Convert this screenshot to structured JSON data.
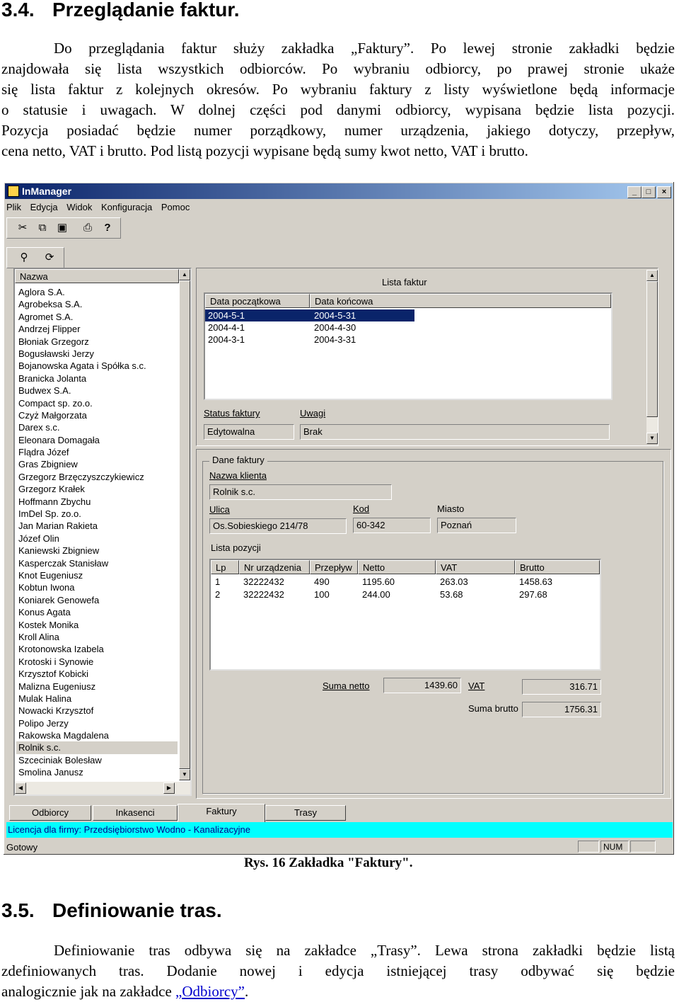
{
  "sec1": {
    "num": "3.4.",
    "title": "Przeglądanie faktur."
  },
  "para1": [
    "Do przeglądania faktur służy zakładka „Faktury”. Po lewej stronie zakładki będzie",
    "znajdowała się lista wszystkich odbiorców. Po wybraniu odbiorcy, po prawej stronie ukaże",
    "się lista faktur z kolejnych okresów. Po wybraniu faktury z listy wyświetlone będą informacje",
    "o statusie i uwagach. W dolnej części pod danymi odbiorcy, wypisana będzie lista pozycji.",
    "Pozycja posiadać będzie numer porządkowy, numer urządzenia, jakiego dotyczy, przepływ,",
    "cena netto, VAT i brutto. Pod listą pozycji wypisane będą sumy kwot netto, VAT i brutto."
  ],
  "window": {
    "title": "InManager",
    "buttons": {
      "min": "_",
      "max": "□",
      "close": "×"
    },
    "menu": [
      "Plik",
      "Edycja",
      "Widok",
      "Konfiguracja",
      "Pomoc"
    ],
    "icons": [
      "scissors-icon",
      "copy-icon",
      "paste-icon",
      "print-icon",
      "help-icon",
      "search-icon",
      "refresh-icon"
    ],
    "customers": {
      "header": "Nazwa",
      "items": [
        "Aglora S.A.",
        "Agrobeksa S.A.",
        "Agromet S.A.",
        "Andrzej Flipper",
        "Błoniak Grzegorz",
        "Bogusławski Jerzy",
        "Bojanowska Agata i Spółka s.c.",
        "Branicka Jolanta",
        "Budwex S.A.",
        "Compact sp. zo.o.",
        "Czyż Małgorzata",
        "Darex s.c.",
        "Eleonara Domagała",
        "Flądra Józef",
        "Gras Zbigniew",
        "Grzegorz Brzęczyszczykiewicz",
        "Grzegorz Krałek",
        "Hoffmann Zbychu",
        "ImDel Sp. zo.o.",
        "Jan Marian Rakieta",
        "Józef Olin",
        "Kaniewski Zbigniew",
        "Kasperczak Stanisław",
        "Knot Eugeniusz",
        "Kobtun Iwona",
        "Koniarek Genowefa",
        "Konus Agata",
        "Kostek Monika",
        "Kroll Alina",
        "Krotonowska Izabela",
        "Krotoski i Synowie",
        "Krzysztof Kobicki",
        "Malizna Eugeniusz",
        "Mulak Halina",
        "Nowacki Krzysztof",
        "Polipo Jerzy",
        "Rakowska Magdalena",
        "Rolnik s.c.",
        "Szceciniak Bolesław",
        "Smolina Janusz"
      ],
      "selected_index": 37
    },
    "invoices": {
      "caption": "Lista faktur",
      "headers": [
        "Data początkowa",
        "Data końcowa"
      ],
      "rows": [
        [
          "2004-5-1",
          "2004-5-31"
        ],
        [
          "2004-4-1",
          "2004-4-30"
        ],
        [
          "2004-3-1",
          "2004-3-31"
        ]
      ],
      "selected_index": 0,
      "status_label": "Status faktury",
      "status_value": "Edytowalna",
      "notes_label": "Uwagi",
      "notes_value": "Brak"
    },
    "details": {
      "group": "Dane faktury",
      "client_label": "Nazwa klienta",
      "client_value": "Rolnik s.c.",
      "street_label": "Ulica",
      "street_value": "Os.Sobieskiego 214/78",
      "code_label": "Kod",
      "code_value": "60-342",
      "city_label": "Miasto",
      "city_value": "Poznań",
      "positions_label": "Lista pozycji",
      "pos_headers": [
        "Lp",
        "Nr urządzenia",
        "Przepływ",
        "Netto",
        "VAT",
        "Brutto"
      ],
      "pos_rows": [
        [
          "1",
          "32222432",
          "490",
          "1195.60",
          "263.03",
          "1458.63"
        ],
        [
          "2",
          "32222432",
          "100",
          "244.00",
          "53.68",
          "297.68"
        ]
      ],
      "sum_netto_label": "Suma netto",
      "sum_netto": "1439.60",
      "vat_label": "VAT",
      "vat": "316.71",
      "sum_brutto_label": "Suma brutto",
      "sum_brutto": "1756.31"
    },
    "tabs": [
      "Odbiorcy",
      "Inkasenci",
      "Faktury",
      "Trasy"
    ],
    "active_tab": 2,
    "license": "Licencja dla firmy: Przedsiębiorstwo Wodno - Kanalizacyjne",
    "status_ready": "Gotowy",
    "status_num": "NUM"
  },
  "caption": "Rys. 16 Zakładka \"Faktury\".",
  "sec2": {
    "num": "3.5.",
    "title": "Definiowanie tras."
  },
  "para2": {
    "line1": "Definiowanie tras odbywa się na zakładce „Trasy”. Lewa strona zakładki będzie listą",
    "line2": "zdefiniowanych tras. Dodanie nowej i edycja istniejącej trasy odbywać się będzie",
    "line3_pre": "analogicznie jak na zakładce ",
    "line3_link": "„Odbiorcy”",
    "line3_post": "."
  }
}
